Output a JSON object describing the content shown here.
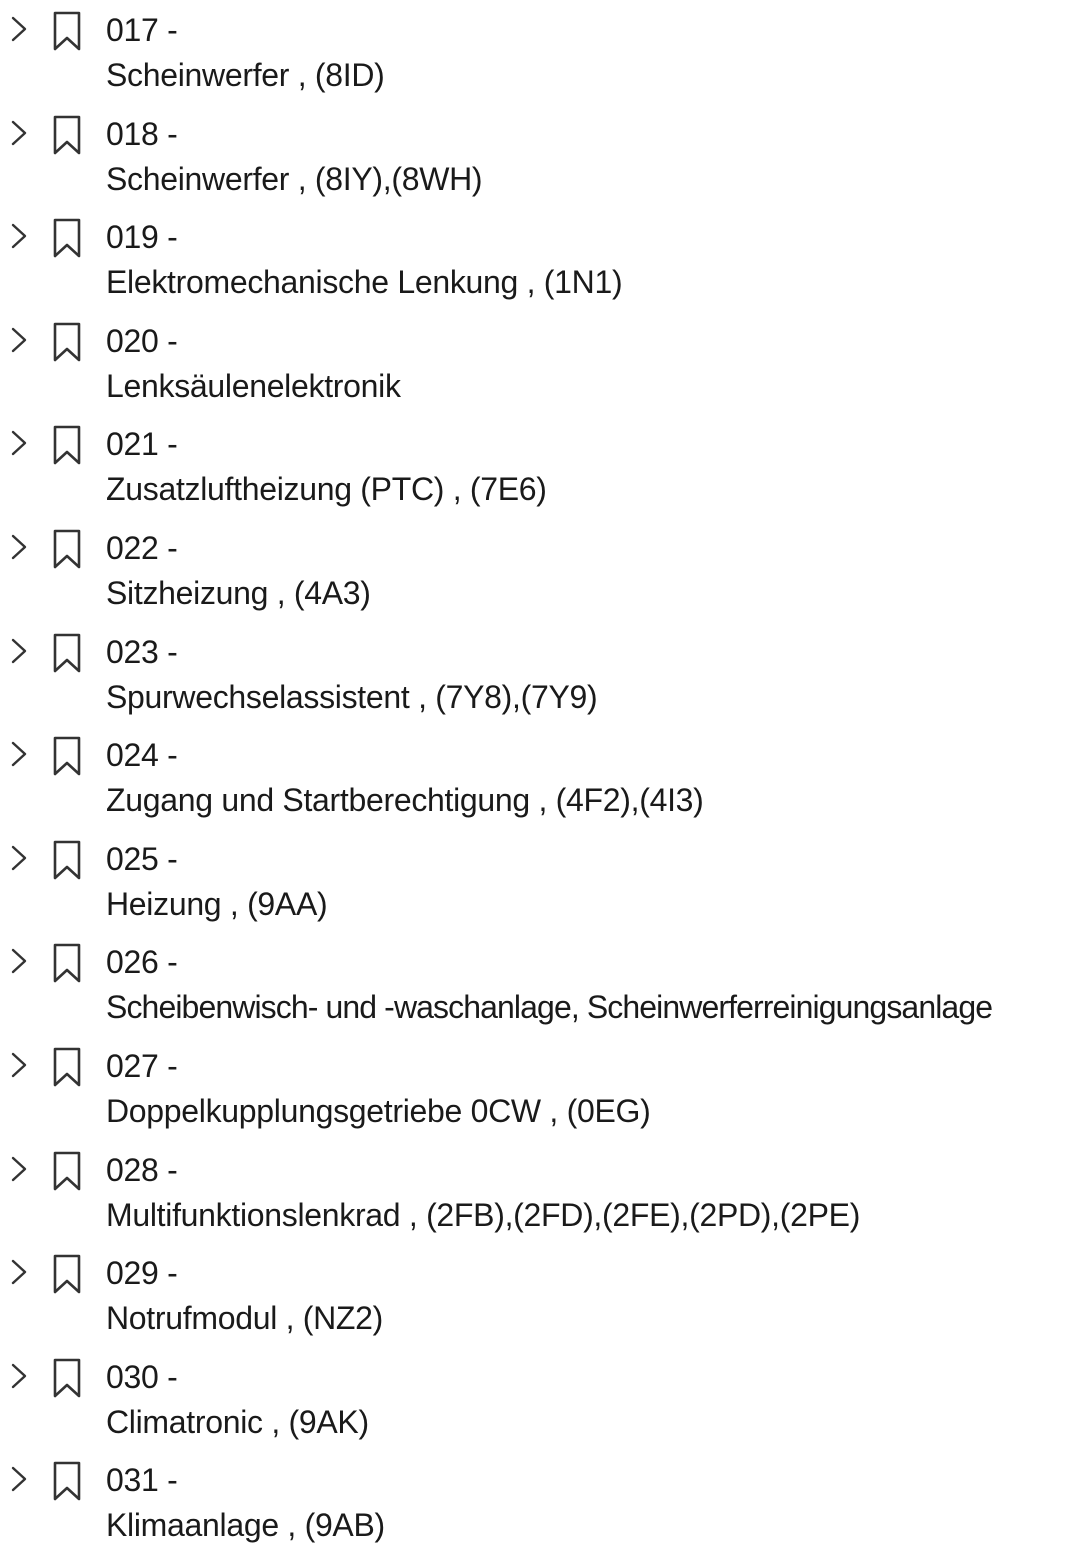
{
  "bookmarks": {
    "items": [
      {
        "number": "017 -",
        "title": "Scheinwerfer , (8ID)"
      },
      {
        "number": "018 -",
        "title": "Scheinwerfer , (8IY),(8WH)"
      },
      {
        "number": "019 -",
        "title": "Elektromechanische Lenkung , (1N1)"
      },
      {
        "number": "020 -",
        "title": "Lenksäulenelektronik"
      },
      {
        "number": "021 -",
        "title": "Zusatzluftheizung (PTC) , (7E6)"
      },
      {
        "number": "022 -",
        "title": "Sitzheizung , (4A3)"
      },
      {
        "number": "023 -",
        "title": "Spurwechselassistent , (7Y8),(7Y9)"
      },
      {
        "number": "024 -",
        "title": "Zugang und Startberechtigung , (4F2),(4I3)"
      },
      {
        "number": "025 -",
        "title": "Heizung , (9AA)"
      },
      {
        "number": "026 -",
        "title": "Scheibenwisch- und -waschanlage, Scheinwerferreinigungsanlage"
      },
      {
        "number": "027 -",
        "title": "Doppelkupplungsgetriebe 0CW , (0EG)"
      },
      {
        "number": "028 -",
        "title": "Multifunktionslenkrad , (2FB),(2FD),(2FE),(2PD),(2PE)"
      },
      {
        "number": "029 -",
        "title": "Notrufmodul , (NZ2)"
      },
      {
        "number": "030 -",
        "title": "Climatronic , (9AK)"
      },
      {
        "number": "031 -",
        "title": "Klimaanlage , (9AB)"
      }
    ]
  },
  "icons": {
    "expand": "chevron-right-icon",
    "bookmark": "bookmark-icon"
  },
  "colors": {
    "text": "#1a1a1a",
    "icon": "#333333",
    "background": "#ffffff"
  }
}
